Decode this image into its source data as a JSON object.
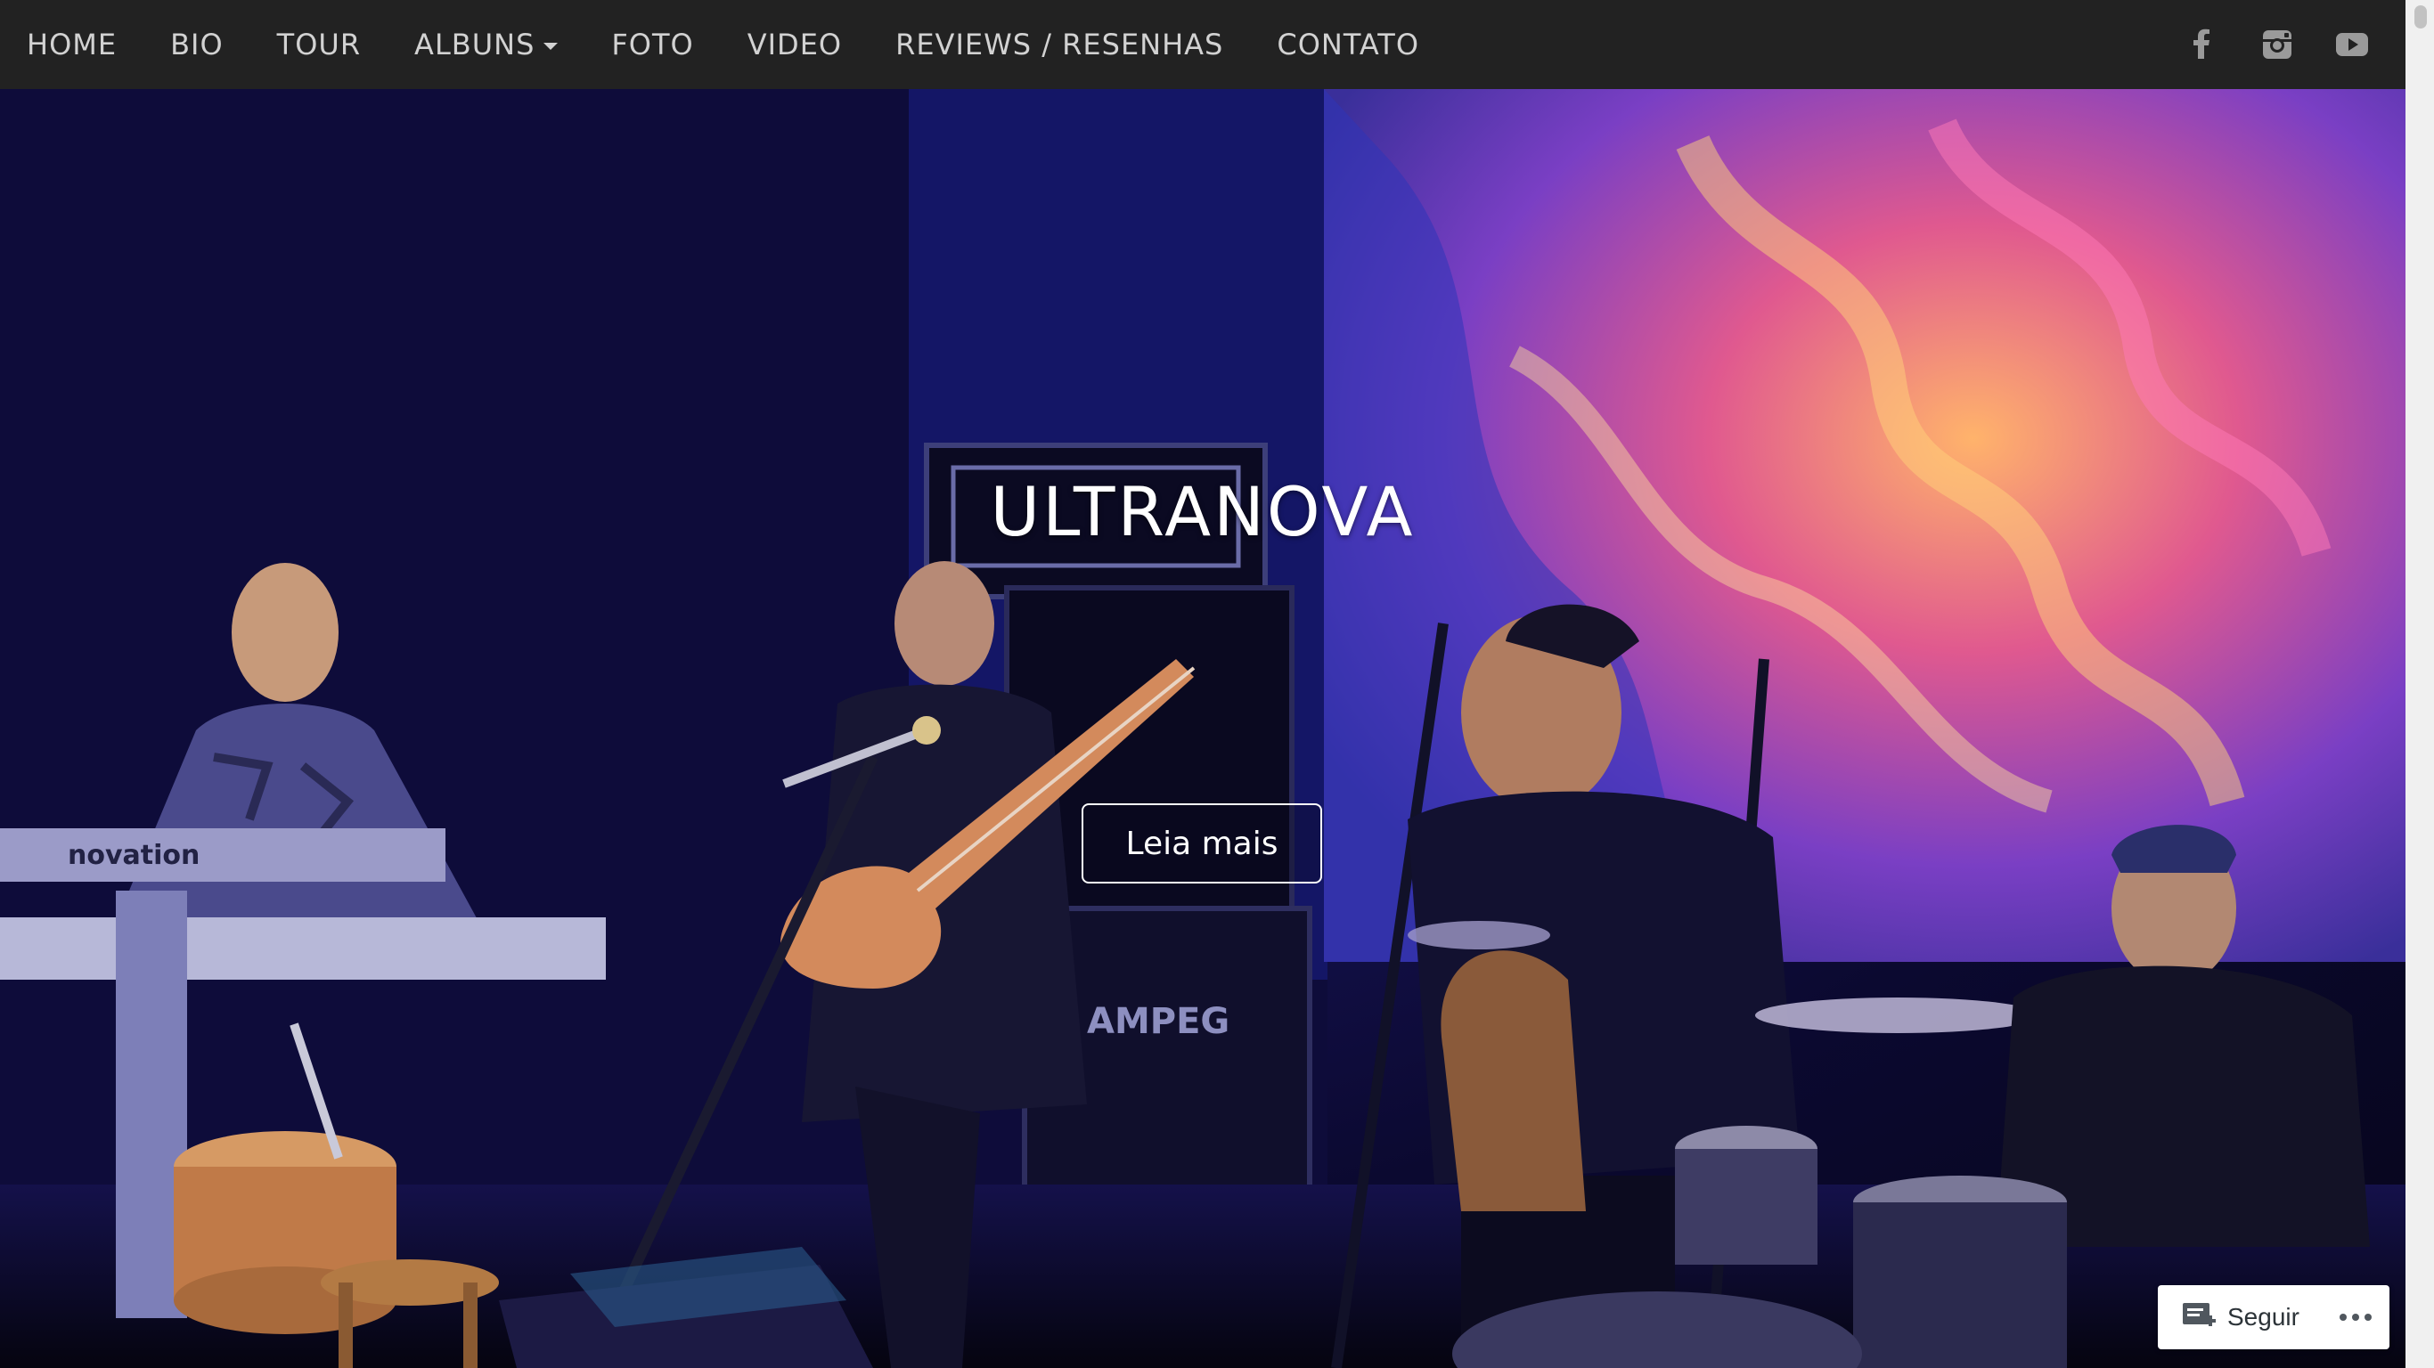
{
  "nav": {
    "items": [
      {
        "label": "HOME"
      },
      {
        "label": "BIO"
      },
      {
        "label": "TOUR"
      },
      {
        "label": "ALBUNS",
        "has_dropdown": true
      },
      {
        "label": "FOTO"
      },
      {
        "label": "VIDEO"
      },
      {
        "label": "REVIEWS / RESENHAS"
      },
      {
        "label": "CONTATO"
      }
    ],
    "social": [
      "facebook-icon",
      "instagram-icon",
      "youtube-icon"
    ]
  },
  "hero": {
    "title": "ULTRANOVA",
    "button_label": "Leia mais",
    "keyboard_brand": "novation",
    "amp_brand": "AMPEG"
  },
  "follow_widget": {
    "label": "Seguir",
    "more_icon": "ellipsis-icon"
  },
  "colors": {
    "navbar_bg": "#222222",
    "nav_text": "#d2d2d2",
    "hero_text": "#ffffff"
  }
}
